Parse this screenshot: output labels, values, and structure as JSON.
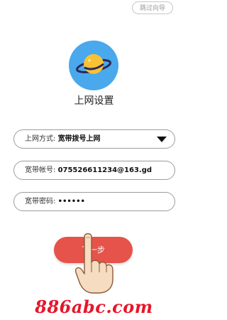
{
  "header": {
    "skip_label": "跳过向导"
  },
  "logo": {
    "icon": "planet-logo-icon",
    "bg_color": "#4aa8ec",
    "planet_color": "#f7c235",
    "ring_color": "#2a2a5a"
  },
  "page": {
    "title": "上网设置"
  },
  "form": {
    "mode_label": "上网方式:",
    "mode_value": "宽带拨号上网",
    "account_label": "宽带帐号:",
    "account_value": "075526611234@163.gd",
    "password_label": "宽带密码:",
    "password_value": "••••••"
  },
  "actions": {
    "next_label": "下一步",
    "next_color": "#e5534a"
  },
  "watermark": {
    "text": "886abc.com",
    "color": "#e8152a"
  }
}
